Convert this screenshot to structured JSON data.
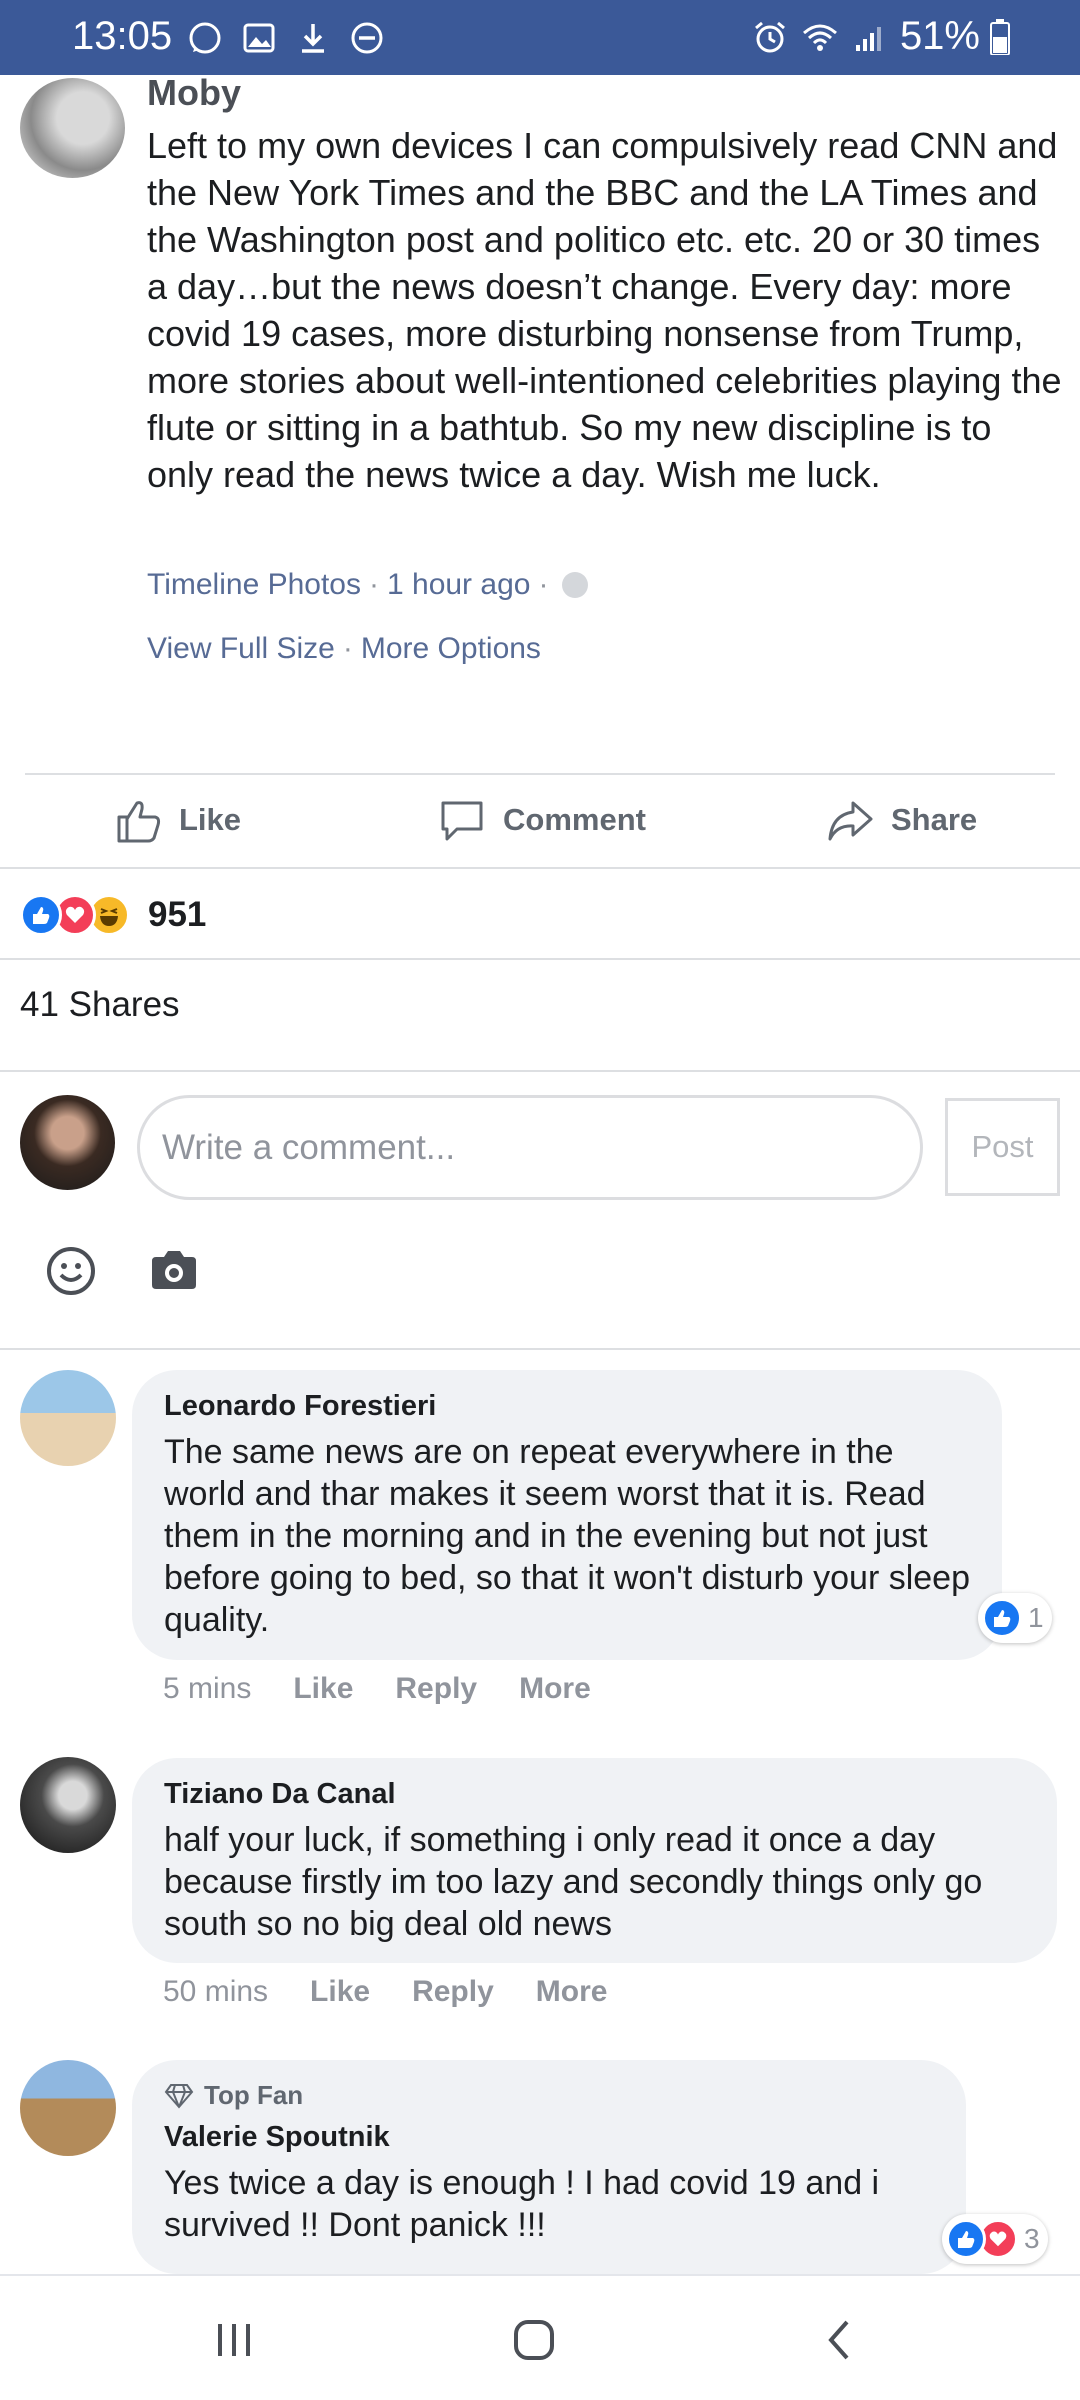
{
  "status_bar": {
    "time": "13:05",
    "battery": "51%",
    "left_icons": [
      "whatsapp-icon",
      "gallery-icon",
      "download-icon",
      "do-not-disturb-icon"
    ],
    "right_icons": [
      "alarm-icon",
      "wifi-icon",
      "signal-icon",
      "battery-icon"
    ]
  },
  "post": {
    "author": "Moby",
    "body": "Left to my own devices I can compulsively read CNN and the New York Times and the BBC and the LA Times and the Washington post and politico etc. etc. 20 or 30 times a day…but the news doesn’t change. Every day: more covid 19 cases, more disturbing nonsense from Trump, more stories about well-intentioned celebrities playing the flute or sitting in a bathtub. So my new discipline is to only read the news twice a day. Wish me luck.",
    "source": "Timeline Photos",
    "time_ago": "1 hour ago",
    "separator": "·",
    "view_full_size": "View Full Size",
    "more_options": "More Options"
  },
  "actions": {
    "like": "Like",
    "comment": "Comment",
    "share": "Share"
  },
  "reactions": {
    "count": "951",
    "icons": [
      "like-reaction-icon",
      "love-reaction-icon",
      "haha-reaction-icon"
    ]
  },
  "shares": "41 Shares",
  "composer": {
    "placeholder": "Write a comment...",
    "post_button": "Post",
    "emoji_icon": "emoji-icon",
    "camera_icon": "camera-icon"
  },
  "comments": [
    {
      "name": "Leonardo Forestieri",
      "text": "The same news are on repeat everywhere in the world and thar makes it seem worst that it is. Read them in the morning and in the evening but not just before going to bed, so that it won't disturb your sleep quality.",
      "time": "5 mins",
      "like": "Like",
      "reply": "Reply",
      "more": "More",
      "reaction_count": "1"
    },
    {
      "name": "Tiziano Da Canal",
      "text": "half your luck, if something i only read it once a day because firstly im too lazy and secondly things only go south so no big deal old news",
      "time": "50 mins",
      "like": "Like",
      "reply": "Reply",
      "more": "More"
    },
    {
      "badge": "Top Fan",
      "name": "Valerie Spoutnik",
      "text": "Yes twice a day is enough ! I had covid 19 and i survived !! Dont panick !!!",
      "reaction_count": "3"
    }
  ],
  "colors": {
    "status_bar": "#3b5998",
    "link": "#576b95",
    "bubble": "#f0f2f5",
    "like_blue": "#1877f2",
    "love_red": "#f33e58",
    "haha_yellow": "#f7b928"
  }
}
